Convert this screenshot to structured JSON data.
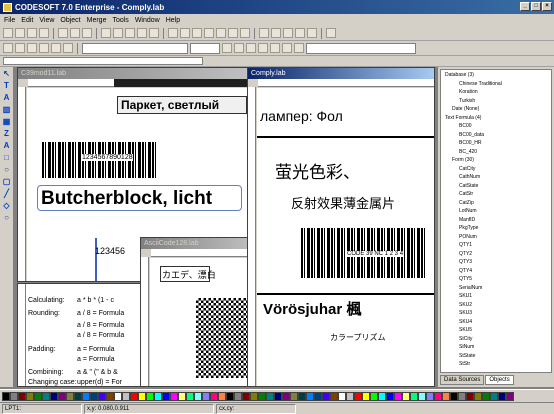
{
  "app": {
    "title": "CODESOFT 7.0 Enterprise - Comply.lab"
  },
  "window_buttons": {
    "minimize": "_",
    "maximize": "□",
    "close": "×"
  },
  "menu": [
    "File",
    "Edit",
    "View",
    "Object",
    "Merge",
    "Tools",
    "Window",
    "Help"
  ],
  "left_tools": [
    "↖",
    "T",
    "A",
    "▥",
    "▦",
    "Z",
    "A",
    "□",
    "○",
    "▢",
    "╱",
    "◇",
    "○"
  ],
  "documents": {
    "doc1": {
      "title": "C39mod11.lab",
      "text_cyrillic": "Паркет, светлый",
      "barcode_digits": "1234567890128",
      "text_big": "Butcherblock, licht",
      "barcode2_digits": "123456"
    },
    "doc2": {
      "title": "Comply.lab",
      "text_lamp": "лампер: Фол",
      "text_cn1": "萤光色彩、",
      "text_cn2": "反射效果薄金属片",
      "barcode_digits": "CODE 39 NC 1 2 3 4",
      "text_hu": "Vörösjuhar 楓",
      "text_kana": "カラープリズム"
    },
    "doc3": {
      "title": "AsciiCode128.lab",
      "text_jp": "カエデ、漂白"
    }
  },
  "formula_panel": {
    "rows": [
      {
        "label": "Calculating:",
        "expr": "a * b * (1 - c"
      },
      {
        "label": "Rounding:",
        "expr": "a / 8 = Formula"
      },
      {
        "label": "",
        "expr": "a / 8 = Formula"
      },
      {
        "label": "",
        "expr": "a / 8 = Formula"
      },
      {
        "label": "Padding:",
        "expr": "a = Formula"
      },
      {
        "label": "",
        "expr": "a = Formula"
      },
      {
        "label": "Combining:",
        "expr": "a & \" (\" & b &"
      },
      {
        "label": "Changing case:",
        "expr": "upper(d) = For"
      }
    ]
  },
  "tree": {
    "items": [
      {
        "label": "Database (3)",
        "indent": 0
      },
      {
        "label": "Chinese Traditional",
        "indent": 2
      },
      {
        "label": "Koration",
        "indent": 2
      },
      {
        "label": "Turkish",
        "indent": 2
      },
      {
        "label": "Date (None)",
        "indent": 1
      },
      {
        "label": "Text Formula (4)",
        "indent": 0
      },
      {
        "label": "BC00",
        "indent": 2
      },
      {
        "label": "BC00_data",
        "indent": 2
      },
      {
        "label": "BC00_HR",
        "indent": 2
      },
      {
        "label": "BC_420",
        "indent": 2
      },
      {
        "label": "Form (30)",
        "indent": 1
      },
      {
        "label": "CatCity",
        "indent": 2
      },
      {
        "label": "CathNum",
        "indent": 2
      },
      {
        "label": "CatState",
        "indent": 2
      },
      {
        "label": "CatStr",
        "indent": 2
      },
      {
        "label": "CatZip",
        "indent": 2
      },
      {
        "label": "LotNum",
        "indent": 2
      },
      {
        "label": "ManfID",
        "indent": 2
      },
      {
        "label": "PkgType",
        "indent": 2
      },
      {
        "label": "PONum",
        "indent": 2
      },
      {
        "label": "QTY1",
        "indent": 2
      },
      {
        "label": "QTY2",
        "indent": 2
      },
      {
        "label": "QTY3",
        "indent": 2
      },
      {
        "label": "QTY4",
        "indent": 2
      },
      {
        "label": "QTY5",
        "indent": 2
      },
      {
        "label": "SerialNum",
        "indent": 2
      },
      {
        "label": "SKU1",
        "indent": 2
      },
      {
        "label": "SKU2",
        "indent": 2
      },
      {
        "label": "SKU3",
        "indent": 2
      },
      {
        "label": "SKU4",
        "indent": 2
      },
      {
        "label": "SKU5",
        "indent": 2
      },
      {
        "label": "StCity",
        "indent": 2
      },
      {
        "label": "StNum",
        "indent": 2
      },
      {
        "label": "StState",
        "indent": 2
      },
      {
        "label": "StStr",
        "indent": 2
      }
    ]
  },
  "panel_tabs": [
    "Data Sources",
    "Objects"
  ],
  "palette_colors": [
    "#000000",
    "#808080",
    "#800000",
    "#808000",
    "#008000",
    "#008080",
    "#000080",
    "#800080",
    "#808040",
    "#004040",
    "#0080ff",
    "#004080",
    "#4000ff",
    "#804000",
    "#ffffff",
    "#c0c0c0",
    "#ff0000",
    "#ffff00",
    "#00ff00",
    "#00ffff",
    "#0000ff",
    "#ff00ff",
    "#ffff80",
    "#00ff80",
    "#80ffff",
    "#8080ff",
    "#ff0080",
    "#ff8040",
    "#000000",
    "#808080",
    "#800000",
    "#808000",
    "#008000",
    "#008080",
    "#000080",
    "#800080",
    "#808040",
    "#004040",
    "#0080ff",
    "#004080",
    "#4000ff",
    "#804000",
    "#ffffff",
    "#c0c0c0",
    "#ff0000",
    "#ffff00",
    "#00ff00",
    "#00ffff",
    "#0000ff",
    "#ff00ff",
    "#ffff80",
    "#00ff80",
    "#80ffff",
    "#8080ff",
    "#ff0080",
    "#ff8040",
    "#000000",
    "#808080",
    "#800000",
    "#808000",
    "#008000",
    "#008080",
    "#000080",
    "#800080"
  ],
  "status": {
    "page": "LPT1:",
    "coords": "x,y: 0.080,0.911",
    "size": "cx,cy:"
  }
}
